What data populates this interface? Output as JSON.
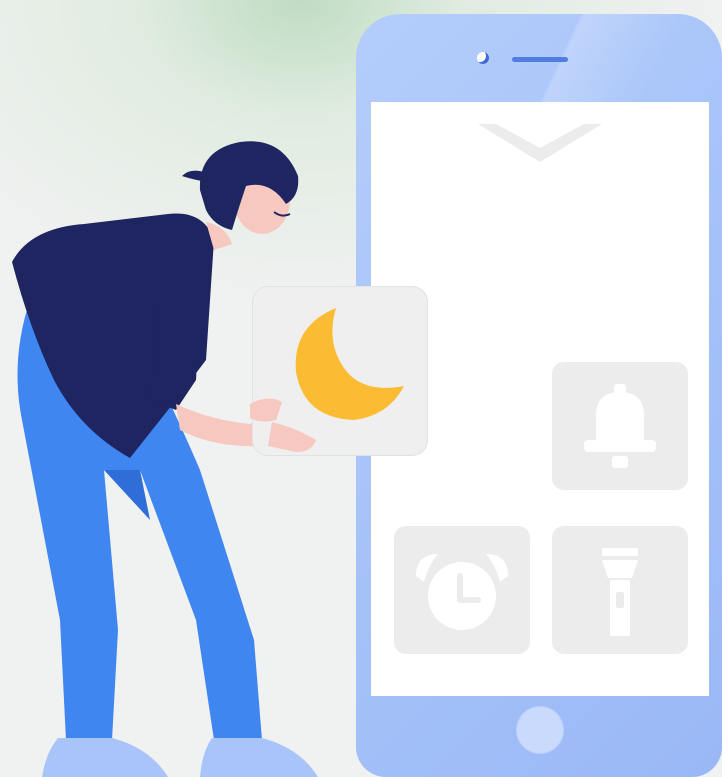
{
  "illustration": {
    "phone": {
      "screen_tiles": [
        {
          "name": "bell-tile",
          "icon": "bell-icon"
        },
        {
          "name": "alarm-clock-tile",
          "icon": "alarm-clock-icon"
        },
        {
          "name": "flashlight-tile",
          "icon": "flashlight-icon"
        }
      ],
      "top_indicator": "chevron-down-icon"
    },
    "held_card": {
      "icon": "moon-icon"
    },
    "colors": {
      "phone_frame": "#a9c4f9",
      "screen": "#ffffff",
      "tile": "#ececec",
      "tile_icon": "#ffffff",
      "moon": "#fbbc34",
      "shirt": "#1f2560",
      "pants": "#3f86f0",
      "hair": "#1f2560",
      "skin": "#f7c8c0",
      "background": "#f0f1f1",
      "glow": "#bfdcc3"
    }
  }
}
